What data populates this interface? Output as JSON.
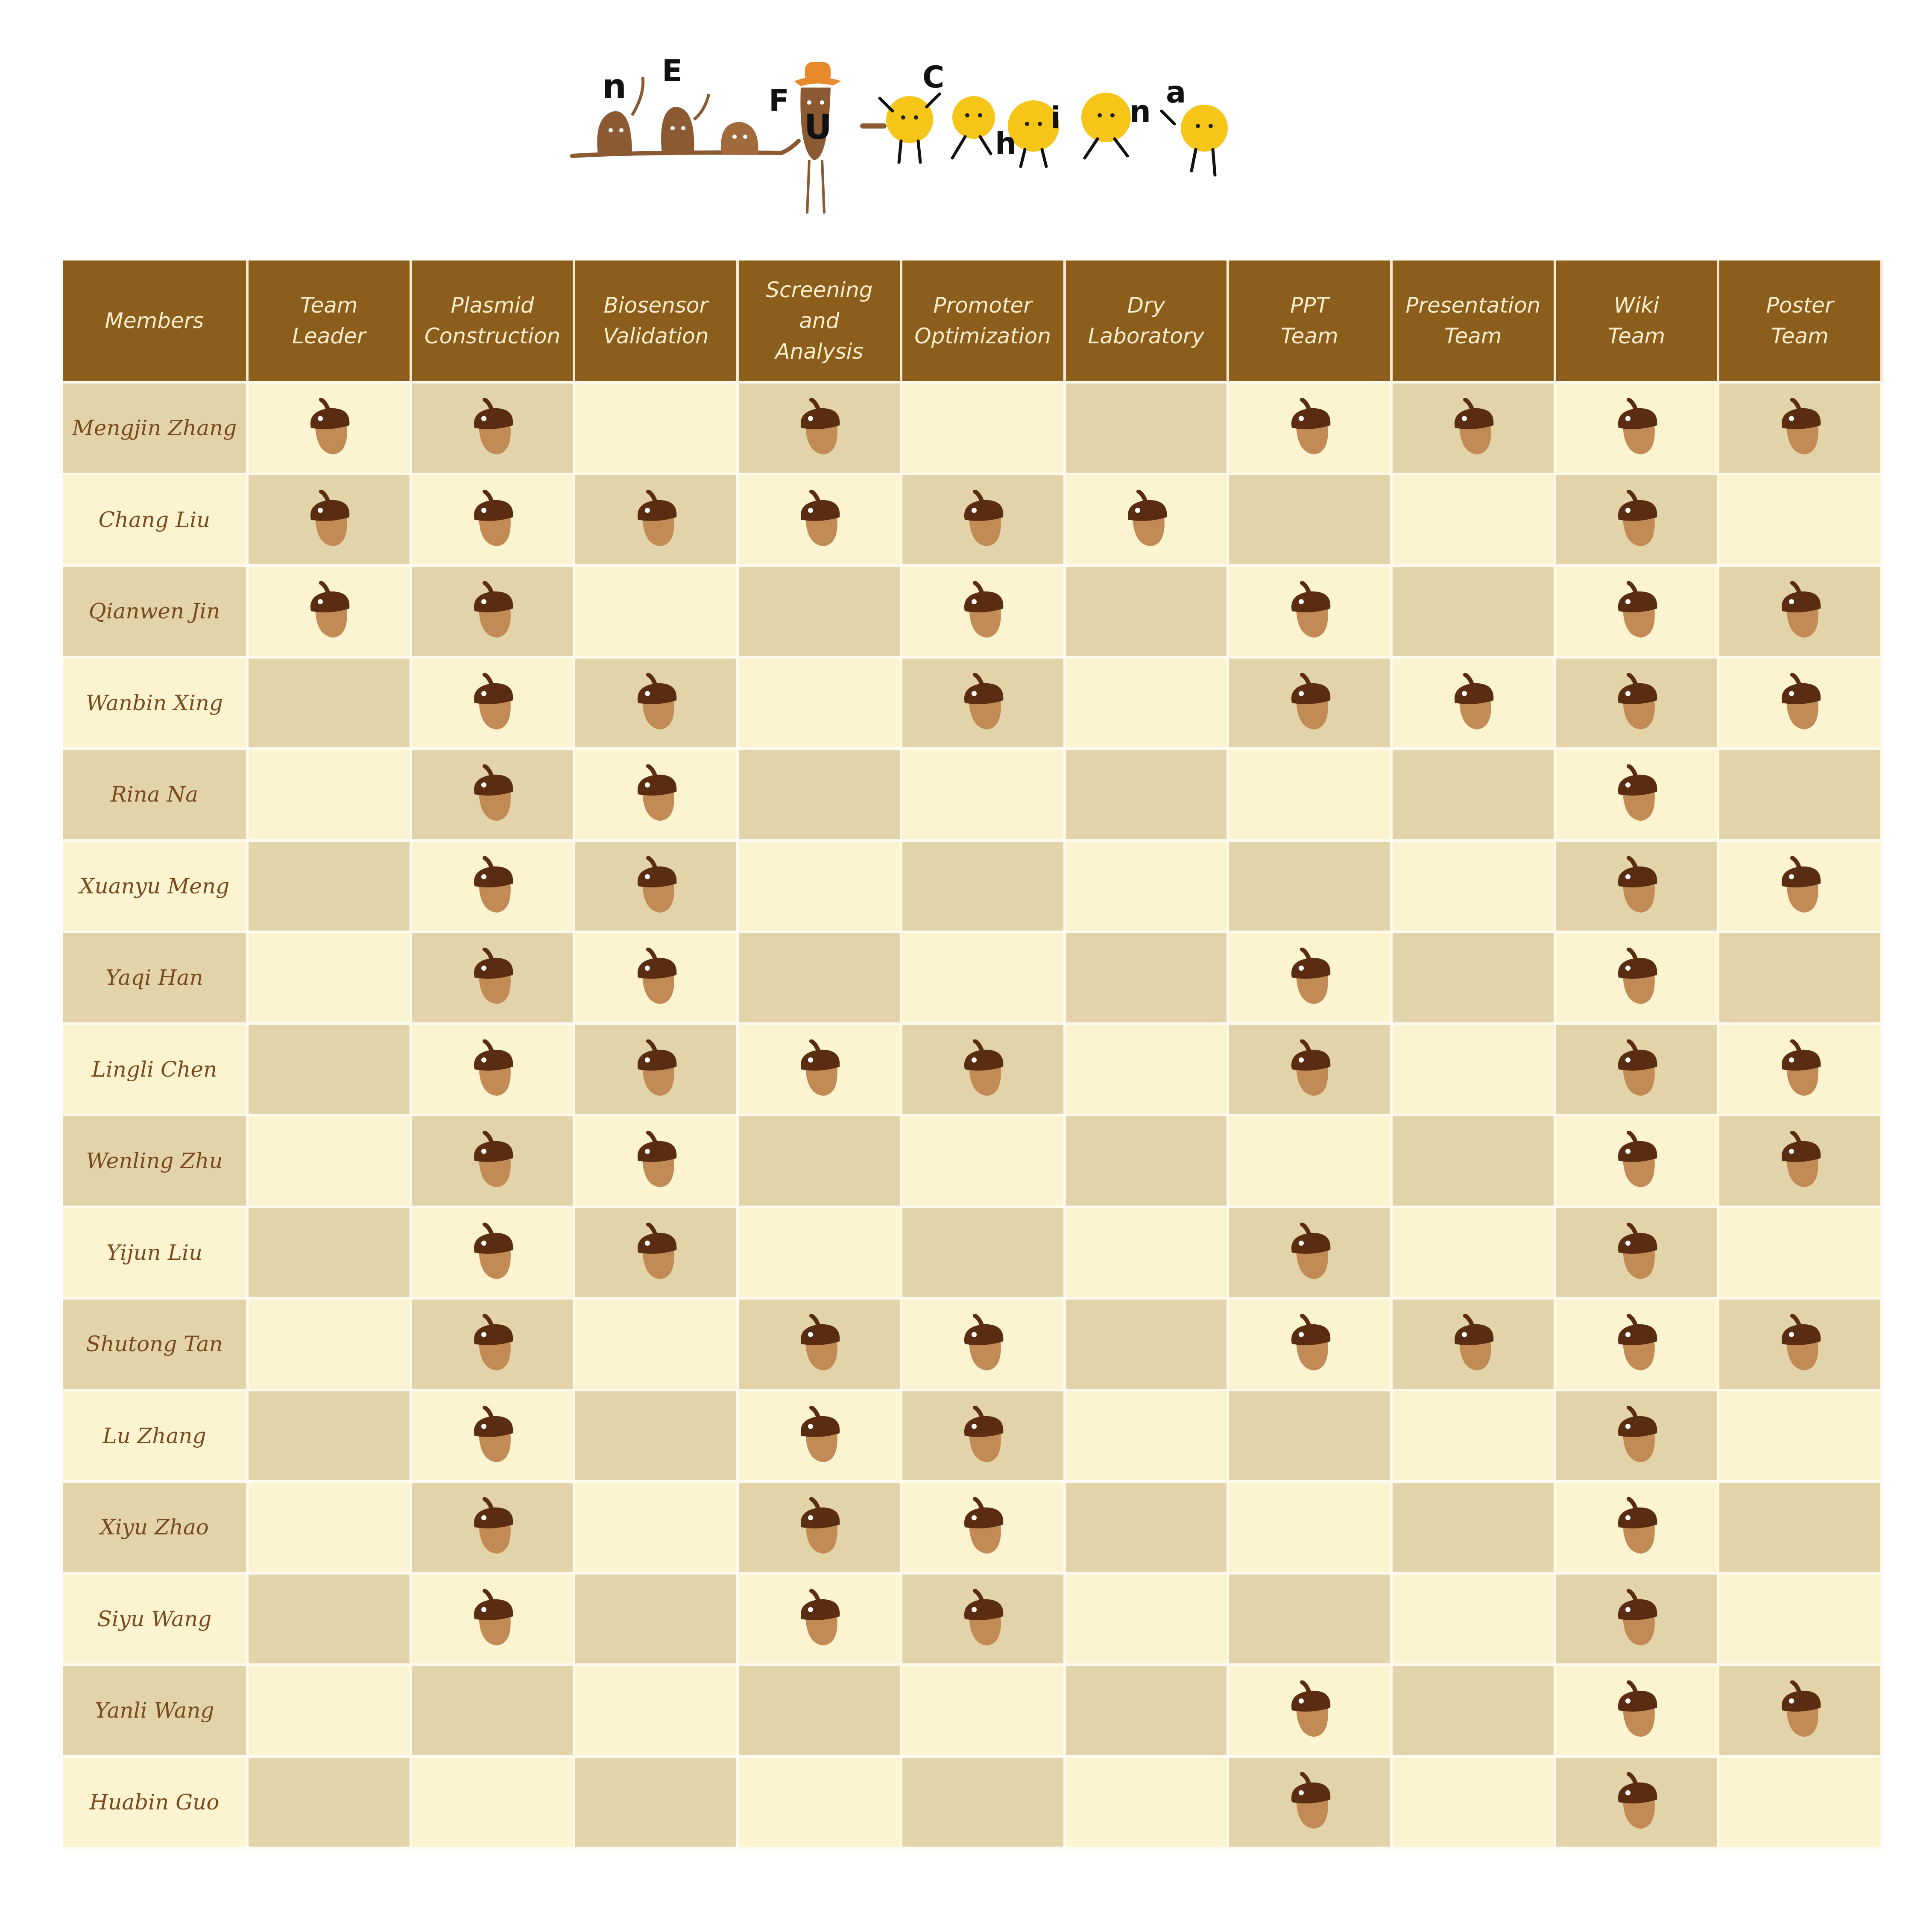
{
  "logo": {
    "letters": [
      "n",
      "E",
      "F",
      "U",
      "C",
      "h",
      "i",
      "n",
      "a"
    ],
    "colors": {
      "brown": "#8b5a33",
      "yellow": "#f5c518",
      "hat": "#e8892b"
    }
  },
  "table": {
    "header_bg": "#8b5e1c",
    "mark_icon": "acorn-icon",
    "columns": [
      {
        "line1": "Members",
        "line2": ""
      },
      {
        "line1": "Team",
        "line2": "Leader"
      },
      {
        "line1": "Plasmid",
        "line2": "Construction"
      },
      {
        "line1": "Biosensor",
        "line2": "Validation"
      },
      {
        "line1": "Screening and",
        "line2": "Analysis"
      },
      {
        "line1": "Promoter",
        "line2": "Optimization"
      },
      {
        "line1": "Dry",
        "line2": "Laboratory"
      },
      {
        "line1": "PPT",
        "line2": "Team"
      },
      {
        "line1": "Presentation",
        "line2": "Team"
      },
      {
        "line1": "Wiki",
        "line2": "Team"
      },
      {
        "line1": "Poster",
        "line2": "Team"
      }
    ],
    "rows": [
      {
        "name": "Mengjin Zhang",
        "marks": [
          1,
          1,
          0,
          1,
          0,
          0,
          1,
          1,
          1,
          1
        ]
      },
      {
        "name": "Chang Liu",
        "marks": [
          1,
          1,
          1,
          1,
          1,
          1,
          0,
          0,
          1,
          0
        ]
      },
      {
        "name": "Qianwen Jin",
        "marks": [
          1,
          1,
          0,
          0,
          1,
          0,
          1,
          0,
          1,
          1
        ]
      },
      {
        "name": "Wanbin Xing",
        "marks": [
          0,
          1,
          1,
          0,
          1,
          0,
          1,
          1,
          1,
          1
        ]
      },
      {
        "name": "Rina Na",
        "marks": [
          0,
          1,
          1,
          0,
          0,
          0,
          0,
          0,
          1,
          0
        ]
      },
      {
        "name": "Xuanyu Meng",
        "marks": [
          0,
          1,
          1,
          0,
          0,
          0,
          0,
          0,
          1,
          1
        ]
      },
      {
        "name": "Yaqi Han",
        "marks": [
          0,
          1,
          1,
          0,
          0,
          0,
          1,
          0,
          1,
          0
        ]
      },
      {
        "name": "Lingli Chen",
        "marks": [
          0,
          1,
          1,
          1,
          1,
          0,
          1,
          0,
          1,
          1
        ]
      },
      {
        "name": "Wenling Zhu",
        "marks": [
          0,
          1,
          1,
          0,
          0,
          0,
          0,
          0,
          1,
          1
        ]
      },
      {
        "name": "Yijun Liu",
        "marks": [
          0,
          1,
          1,
          0,
          0,
          0,
          1,
          0,
          1,
          0
        ]
      },
      {
        "name": "Shutong Tan",
        "marks": [
          0,
          1,
          0,
          1,
          1,
          0,
          1,
          1,
          1,
          1
        ]
      },
      {
        "name": "Lu Zhang",
        "marks": [
          0,
          1,
          0,
          1,
          1,
          0,
          0,
          0,
          1,
          0
        ]
      },
      {
        "name": "Xiyu Zhao",
        "marks": [
          0,
          1,
          0,
          1,
          1,
          0,
          0,
          0,
          1,
          0
        ]
      },
      {
        "name": "Siyu Wang",
        "marks": [
          0,
          1,
          0,
          1,
          1,
          0,
          0,
          0,
          1,
          0
        ]
      },
      {
        "name": "Yanli Wang",
        "marks": [
          0,
          0,
          0,
          0,
          0,
          0,
          1,
          0,
          1,
          1
        ]
      },
      {
        "name": "Huabin Guo",
        "marks": [
          0,
          0,
          0,
          0,
          0,
          0,
          1,
          0,
          1,
          0
        ]
      }
    ]
  }
}
